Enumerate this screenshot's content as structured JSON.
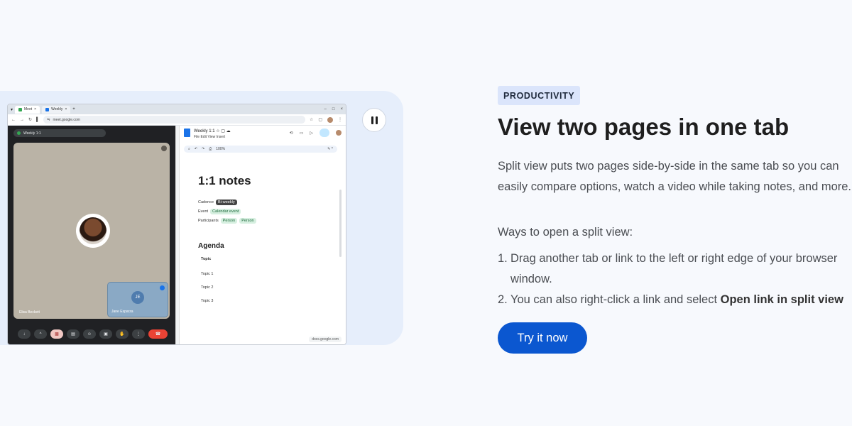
{
  "colors": {
    "accent": "#0b57d0",
    "badge_bg": "#dbe5fb",
    "page_bg": "#f7f9fd",
    "illustration_bg": "#e6eefb"
  },
  "illustration": {
    "pause_icon": "pause-icon",
    "browser": {
      "tabs": [
        {
          "label": "Meet"
        },
        {
          "label": "Weekly"
        }
      ],
      "url": "meet.google.com"
    },
    "meet": {
      "meeting_title": "Weekly 1:1",
      "speaker": "Elisa Beckett",
      "pip_initials": "JE",
      "pip_name": "Jane Esparza"
    },
    "docs": {
      "title": "Weekly 1:1",
      "menu": [
        "File",
        "Edit",
        "View",
        "Insert"
      ],
      "zoom": "100%",
      "heading": "1:1 notes",
      "cadence_label": "Cadence",
      "cadence_value": "Bi-weekly",
      "event_label": "Event",
      "event_value": "Calendar event",
      "participants_label": "Participants",
      "person_1": "Person",
      "person_2": "Person",
      "agenda_heading": "Agenda",
      "topic_header": "Topic",
      "topics": [
        "Topic 1",
        "Topic 2",
        "Topic 3"
      ],
      "footer_url": "docs.google.com"
    }
  },
  "content": {
    "badge": "PRODUCTIVITY",
    "headline": "View two pages in one tab",
    "description": "Split view puts two pages side-by-side in the same tab so you can easily compare options, watch a video while taking notes, and more.",
    "ways_intro": "Ways to open a split view:",
    "steps": [
      {
        "num": "1.",
        "text": "Drag another tab or link to the left or right edge of your browser window."
      },
      {
        "num": "2.",
        "text_pre": "You can also right-click a link and select ",
        "text_bold": "Open link in split view"
      }
    ],
    "cta": "Try it now"
  }
}
